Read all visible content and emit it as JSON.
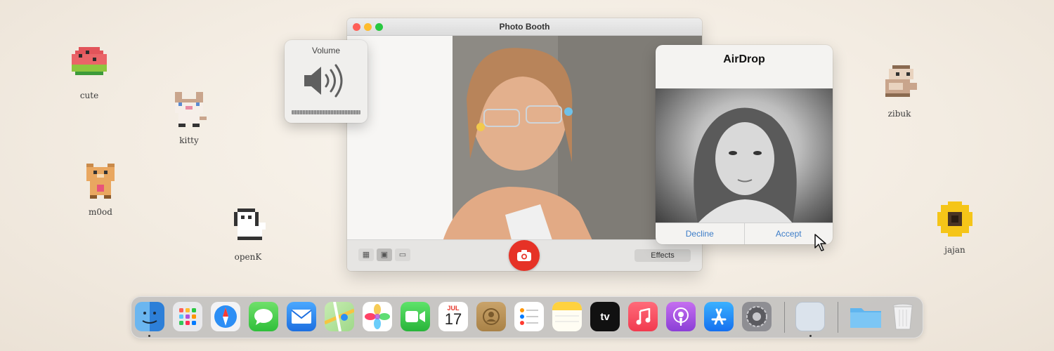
{
  "desktop_icons": [
    {
      "label": "cute",
      "icon": "watermelon-icon"
    },
    {
      "label": "kitty",
      "icon": "cat-icon"
    },
    {
      "label": "m0od",
      "icon": "bear-icon"
    },
    {
      "label": "openK",
      "icon": "dog-icon"
    },
    {
      "label": "zibuk",
      "icon": "hamster-icon"
    },
    {
      "label": "jajan",
      "icon": "sunflower-icon"
    }
  ],
  "photo_booth": {
    "title": "Photo Booth",
    "effects_label": "Effects"
  },
  "volume": {
    "title": "Volume",
    "level": 1.0
  },
  "airdrop": {
    "title": "AirDrop",
    "decline_label": "Decline",
    "accept_label": "Accept"
  },
  "dock": {
    "calendar_month": "JUL",
    "calendar_day": "17",
    "tv_label": "tv",
    "apps": [
      "finder",
      "launchpad",
      "safari",
      "messages",
      "mail",
      "maps",
      "photos",
      "facetime",
      "calendar",
      "contacts",
      "reminders",
      "notes",
      "apple-tv",
      "music",
      "podcasts",
      "app-store",
      "system-preferences",
      "preview",
      "downloads-folder",
      "trash"
    ]
  },
  "colors": {
    "shutter": "#e63226",
    "airdrop_button": "#3d7dc8"
  }
}
